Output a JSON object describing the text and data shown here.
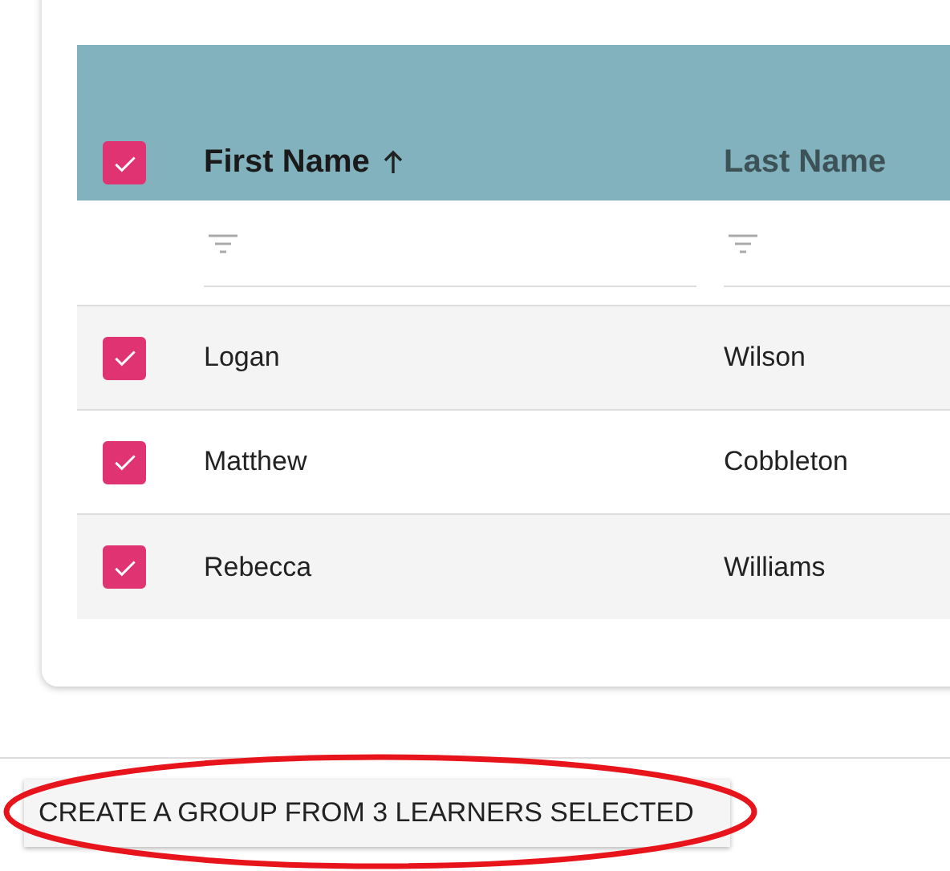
{
  "table": {
    "select_all": {
      "checked": true
    },
    "columns": [
      {
        "label": "First Name",
        "sorted": true
      },
      {
        "label": "Last Name",
        "sorted": false
      }
    ],
    "rows": [
      {
        "checked": true,
        "cells": [
          "Logan",
          "Wilson"
        ]
      },
      {
        "checked": true,
        "cells": [
          "Matthew",
          "Cobbleton"
        ]
      },
      {
        "checked": true,
        "cells": [
          "Rebecca",
          "Williams"
        ]
      }
    ]
  },
  "action_button": {
    "label": "CREATE A GROUP FROM 3 LEARNERS SELECTED",
    "highlighted": true
  }
}
